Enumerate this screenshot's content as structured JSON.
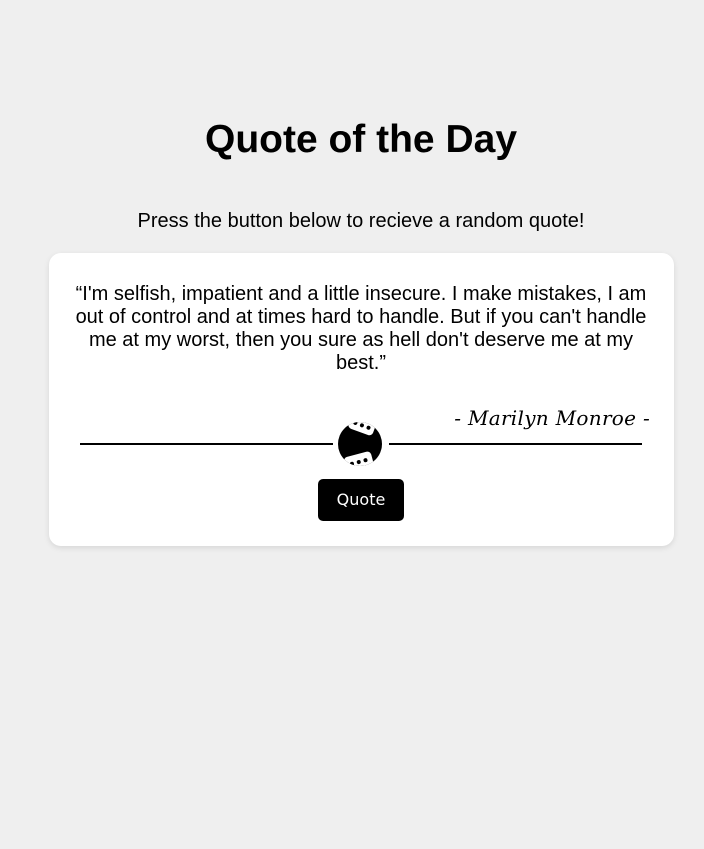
{
  "header": {
    "title": "Quote of the Day",
    "subtitle": "Press the button below to recieve a random quote!"
  },
  "quote_card": {
    "quote": "“I'm selfish, impatient and a little insecure. I make mistakes, I am out of control and at times hard to handle. But if you can't handle me at my worst, then you sure as hell don't deserve me at my best.”",
    "author": "- Marilyn Monroe -",
    "divider_icon": "dice-icon",
    "button_label": "Quote"
  },
  "colors": {
    "page_background": "#efefef",
    "card_background": "#ffffff",
    "button_background": "#000000",
    "button_text": "#ffffff",
    "text": "#000000"
  }
}
